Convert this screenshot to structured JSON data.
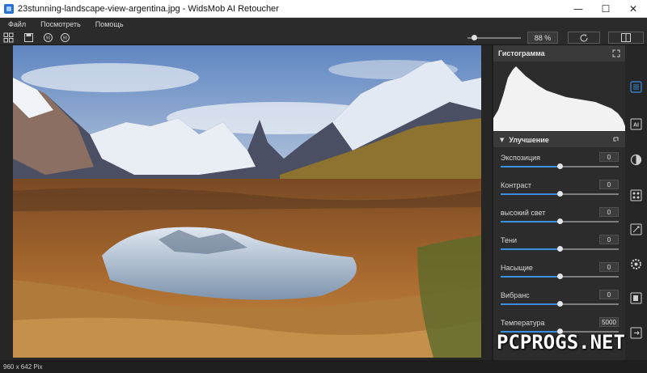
{
  "window": {
    "title": "23stunning-landscape-view-argentina.jpg - WidsMob AI Retoucher",
    "minimize": "—",
    "maximize": "☐",
    "close": "✕"
  },
  "menu": {
    "items": [
      "Файл",
      "Посмотреть",
      "Помощь"
    ]
  },
  "toolbar": {
    "zoom_label": "88 %",
    "zoom_fraction": 0.12,
    "icons": [
      "grid-icon",
      "save-icon",
      "rotate-left-icon",
      "rotate-right-icon",
      "refresh-icon",
      "compare-icon"
    ]
  },
  "panel": {
    "histogram_title": "Гистограмма",
    "section_title": "Улучшение",
    "section_arrow": "▼",
    "sliders": [
      {
        "label": "Экспозиция",
        "value": "0",
        "fraction": 0.5
      },
      {
        "label": "Контраст",
        "value": "0",
        "fraction": 0.5
      },
      {
        "label": "высокий свет",
        "value": "0",
        "fraction": 0.5
      },
      {
        "label": "Тени",
        "value": "0",
        "fraction": 0.5
      },
      {
        "label": "Насыщие",
        "value": "0",
        "fraction": 0.5
      },
      {
        "label": "Вибранс",
        "value": "0",
        "fraction": 0.5
      },
      {
        "label": "Температура",
        "value": "5000",
        "fraction": 0.5
      }
    ]
  },
  "sidebar": {
    "icons": [
      "enhance-icon",
      "ai-icon",
      "tone-icon",
      "filter-icon",
      "effects-icon",
      "gear-icon",
      "copy-icon",
      "export-icon"
    ]
  },
  "status": {
    "dimensions": "960 x 642 Pix"
  },
  "watermark": "PCPROGS.NET",
  "colors": {
    "accent": "#3b8fe0",
    "panel": "#2c2c2c",
    "background": "#1e1e1e"
  }
}
